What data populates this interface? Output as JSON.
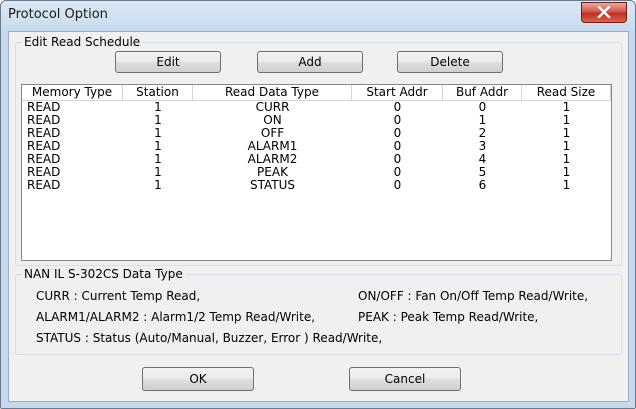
{
  "window": {
    "title": "Protocol Option"
  },
  "schedule": {
    "group_label": "Edit Read Schedule",
    "edit_label": "Edit",
    "add_label": "Add",
    "delete_label": "Delete",
    "columns": [
      "Memory Type",
      "Station",
      "Read Data Type",
      "Start Addr",
      "Buf Addr",
      "Read Size"
    ],
    "rows": [
      [
        "READ",
        "1",
        "CURR",
        "0",
        "0",
        "1"
      ],
      [
        "READ",
        "1",
        "ON",
        "0",
        "1",
        "1"
      ],
      [
        "READ",
        "1",
        "OFF",
        "0",
        "2",
        "1"
      ],
      [
        "READ",
        "1",
        "ALARM1",
        "0",
        "3",
        "1"
      ],
      [
        "READ",
        "1",
        "ALARM2",
        "0",
        "4",
        "1"
      ],
      [
        "READ",
        "1",
        "PEAK",
        "0",
        "5",
        "1"
      ],
      [
        "READ",
        "1",
        "STATUS",
        "0",
        "6",
        "1"
      ]
    ]
  },
  "datatype": {
    "group_label": "NAN IL S-302CS Data Type",
    "line1_left": "CURR : Current Temp Read,",
    "line1_right": "ON/OFF : Fan On/Off Temp Read/Write,",
    "line2_left": "ALARM1/ALARM2 : Alarm1/2 Temp Read/Write,",
    "line2_right": "PEAK : Peak Temp Read/Write,",
    "line3": "STATUS : Status (Auto/Manual, Buzzer, Error ) Read/Write,"
  },
  "footer": {
    "ok_label": "OK",
    "cancel_label": "Cancel"
  }
}
